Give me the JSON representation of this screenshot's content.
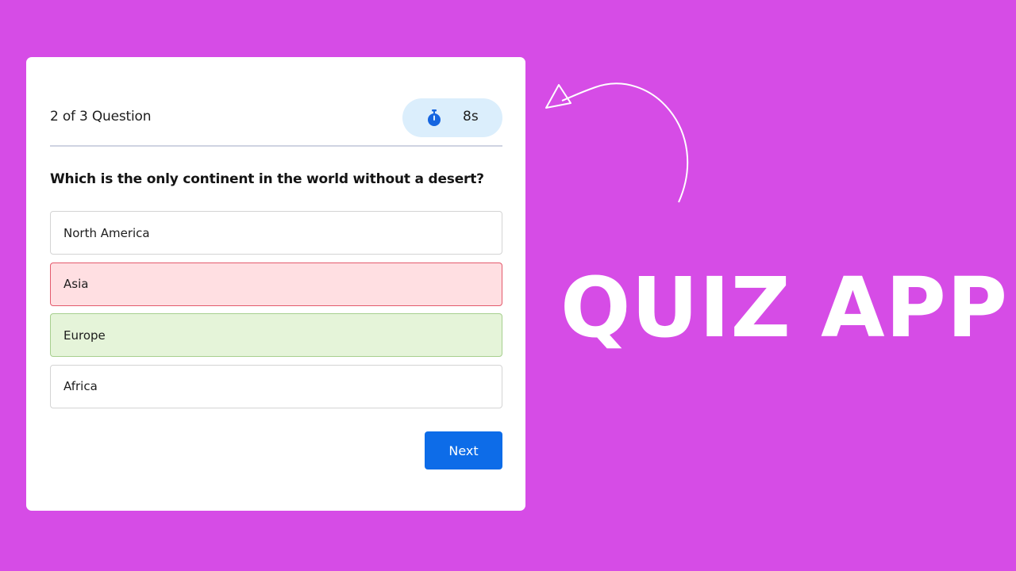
{
  "header": {
    "question_count": "2 of 3 Question",
    "timer": "8s",
    "timer_icon": "stopwatch-icon"
  },
  "question": {
    "text": "Which is the only continent in the world without a desert?"
  },
  "options": [
    {
      "label": "North America",
      "state": "default"
    },
    {
      "label": "Asia",
      "state": "wrong"
    },
    {
      "label": "Europe",
      "state": "correct"
    },
    {
      "label": "Africa",
      "state": "default"
    }
  ],
  "actions": {
    "next_label": "Next"
  },
  "banner": {
    "title": "QUIZ APP",
    "arrow_icon": "curved-arrow-icon"
  },
  "colors": {
    "background": "#d64ce6",
    "accent": "#0d6ce8",
    "wrong_bg": "#ffdfe2",
    "correct_bg": "#e5f4d9",
    "timer_bg": "#dbeefc"
  }
}
